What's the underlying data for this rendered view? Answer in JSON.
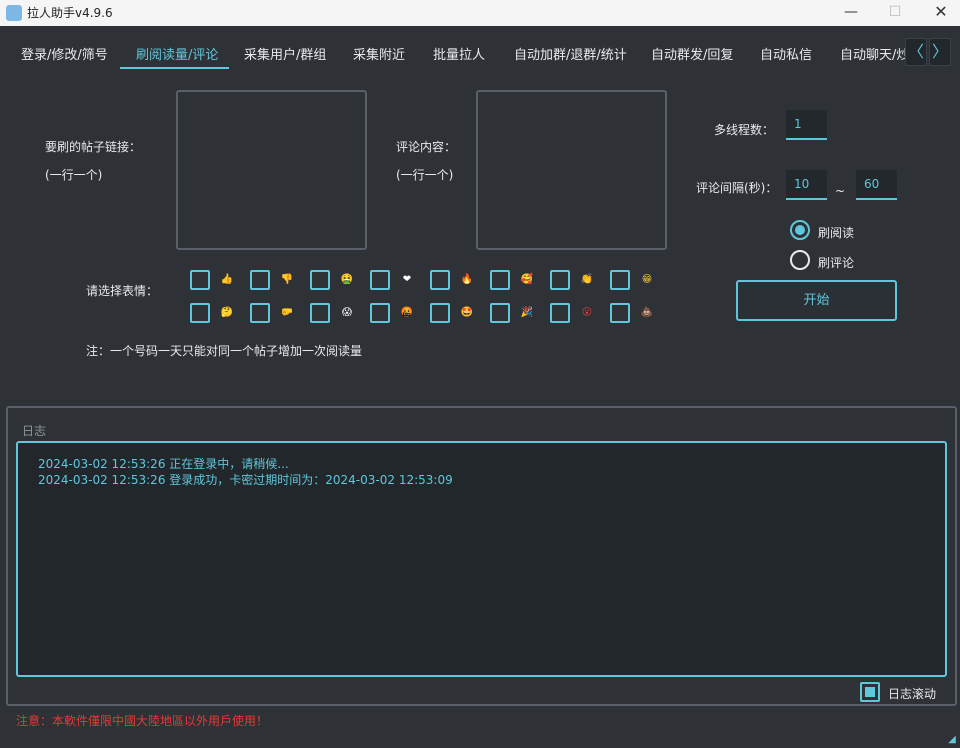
{
  "window": {
    "title": "拉人助手v4.9.6",
    "minimize_glyph": "—",
    "maximize_glyph": "☐",
    "close_glyph": "✕"
  },
  "tabs": [
    {
      "label": "登录/修改/筛号",
      "active": false
    },
    {
      "label": "刷阅读量/评论",
      "active": true
    },
    {
      "label": "采集用户/群组",
      "active": false
    },
    {
      "label": "采集附近",
      "active": false
    },
    {
      "label": "批量拉人",
      "active": false
    },
    {
      "label": "自动加群/退群/统计",
      "active": false
    },
    {
      "label": "自动群发/回复",
      "active": false
    },
    {
      "label": "自动私信",
      "active": false
    },
    {
      "label": "自动聊天/炒",
      "active": false
    }
  ],
  "tab_scroll": {
    "left_glyph": "〈",
    "right_glyph": "〉"
  },
  "form": {
    "post_link_label": "要刷的帖子链接：",
    "post_link_hint": "(一行一个)",
    "comment_label": "评论内容：",
    "comment_hint": "(一行一个)",
    "threads_label": "多线程数：",
    "threads_value": "1",
    "interval_label": "评论间隔(秒)：",
    "interval_min": "10",
    "interval_sep": "~",
    "interval_max": "60",
    "mode_options": [
      {
        "label": "刷阅读",
        "checked": true
      },
      {
        "label": "刷评论",
        "checked": false
      }
    ],
    "start_label": "开始",
    "emoji_label": "请选择表情：",
    "emoji_row1": [
      {
        "name": "thumbs-up-icon",
        "glyph": "👍",
        "color": "#f5c542"
      },
      {
        "name": "thumbs-down-icon",
        "glyph": "👎",
        "color": "#f5c542"
      },
      {
        "name": "sick-face-icon",
        "glyph": "🤮",
        "color": "#7cb342"
      },
      {
        "name": "heart-icon",
        "glyph": "❤",
        "color": "#ffffff"
      },
      {
        "name": "fire-icon",
        "glyph": "🔥",
        "color": "#ff7043"
      },
      {
        "name": "heart-eyes-icon",
        "glyph": "🥰",
        "color": "#f5a623"
      },
      {
        "name": "clap-icon",
        "glyph": "👏",
        "color": "#f5c542"
      },
      {
        "name": "laughing-face-icon",
        "glyph": "😁",
        "color": "#f5c542"
      }
    ],
    "emoji_row2": [
      {
        "name": "thinking-face-icon",
        "glyph": "🤔",
        "color": "#f5c542"
      },
      {
        "name": "raised-fist-icon",
        "glyph": "🤛",
        "color": "#f0d8b0"
      },
      {
        "name": "screaming-face-icon",
        "glyph": "😱",
        "color": "#e8eaec"
      },
      {
        "name": "angry-face-icon",
        "glyph": "🤬",
        "color": "#e53935"
      },
      {
        "name": "star-eyes-icon",
        "glyph": "🤩",
        "color": "#f5c542"
      },
      {
        "name": "party-popper-icon",
        "glyph": "🎉",
        "color": "#ab47bc"
      },
      {
        "name": "open-mouth-icon",
        "glyph": "😮",
        "color": "#e53935"
      },
      {
        "name": "poop-icon",
        "glyph": "💩",
        "color": "#8d5524"
      }
    ],
    "note": "注：一个号码一天只能对同一个帖子增加一次阅读量"
  },
  "log": {
    "title": "日志",
    "lines": [
      "2024-03-02 12:53:26 正在登录中，请稍候...",
      "2024-03-02 12:53:26 登录成功，卡密过期时间为：2024-03-02 12:53:09"
    ],
    "scroll_label": "日志滚动",
    "scroll_checked": true
  },
  "warning": "注意：本軟件僅限中國大陸地區以外用戶使用！",
  "colors": {
    "accent": "#5fc7dc",
    "background": "#2e3237",
    "warning": "#e53935"
  }
}
